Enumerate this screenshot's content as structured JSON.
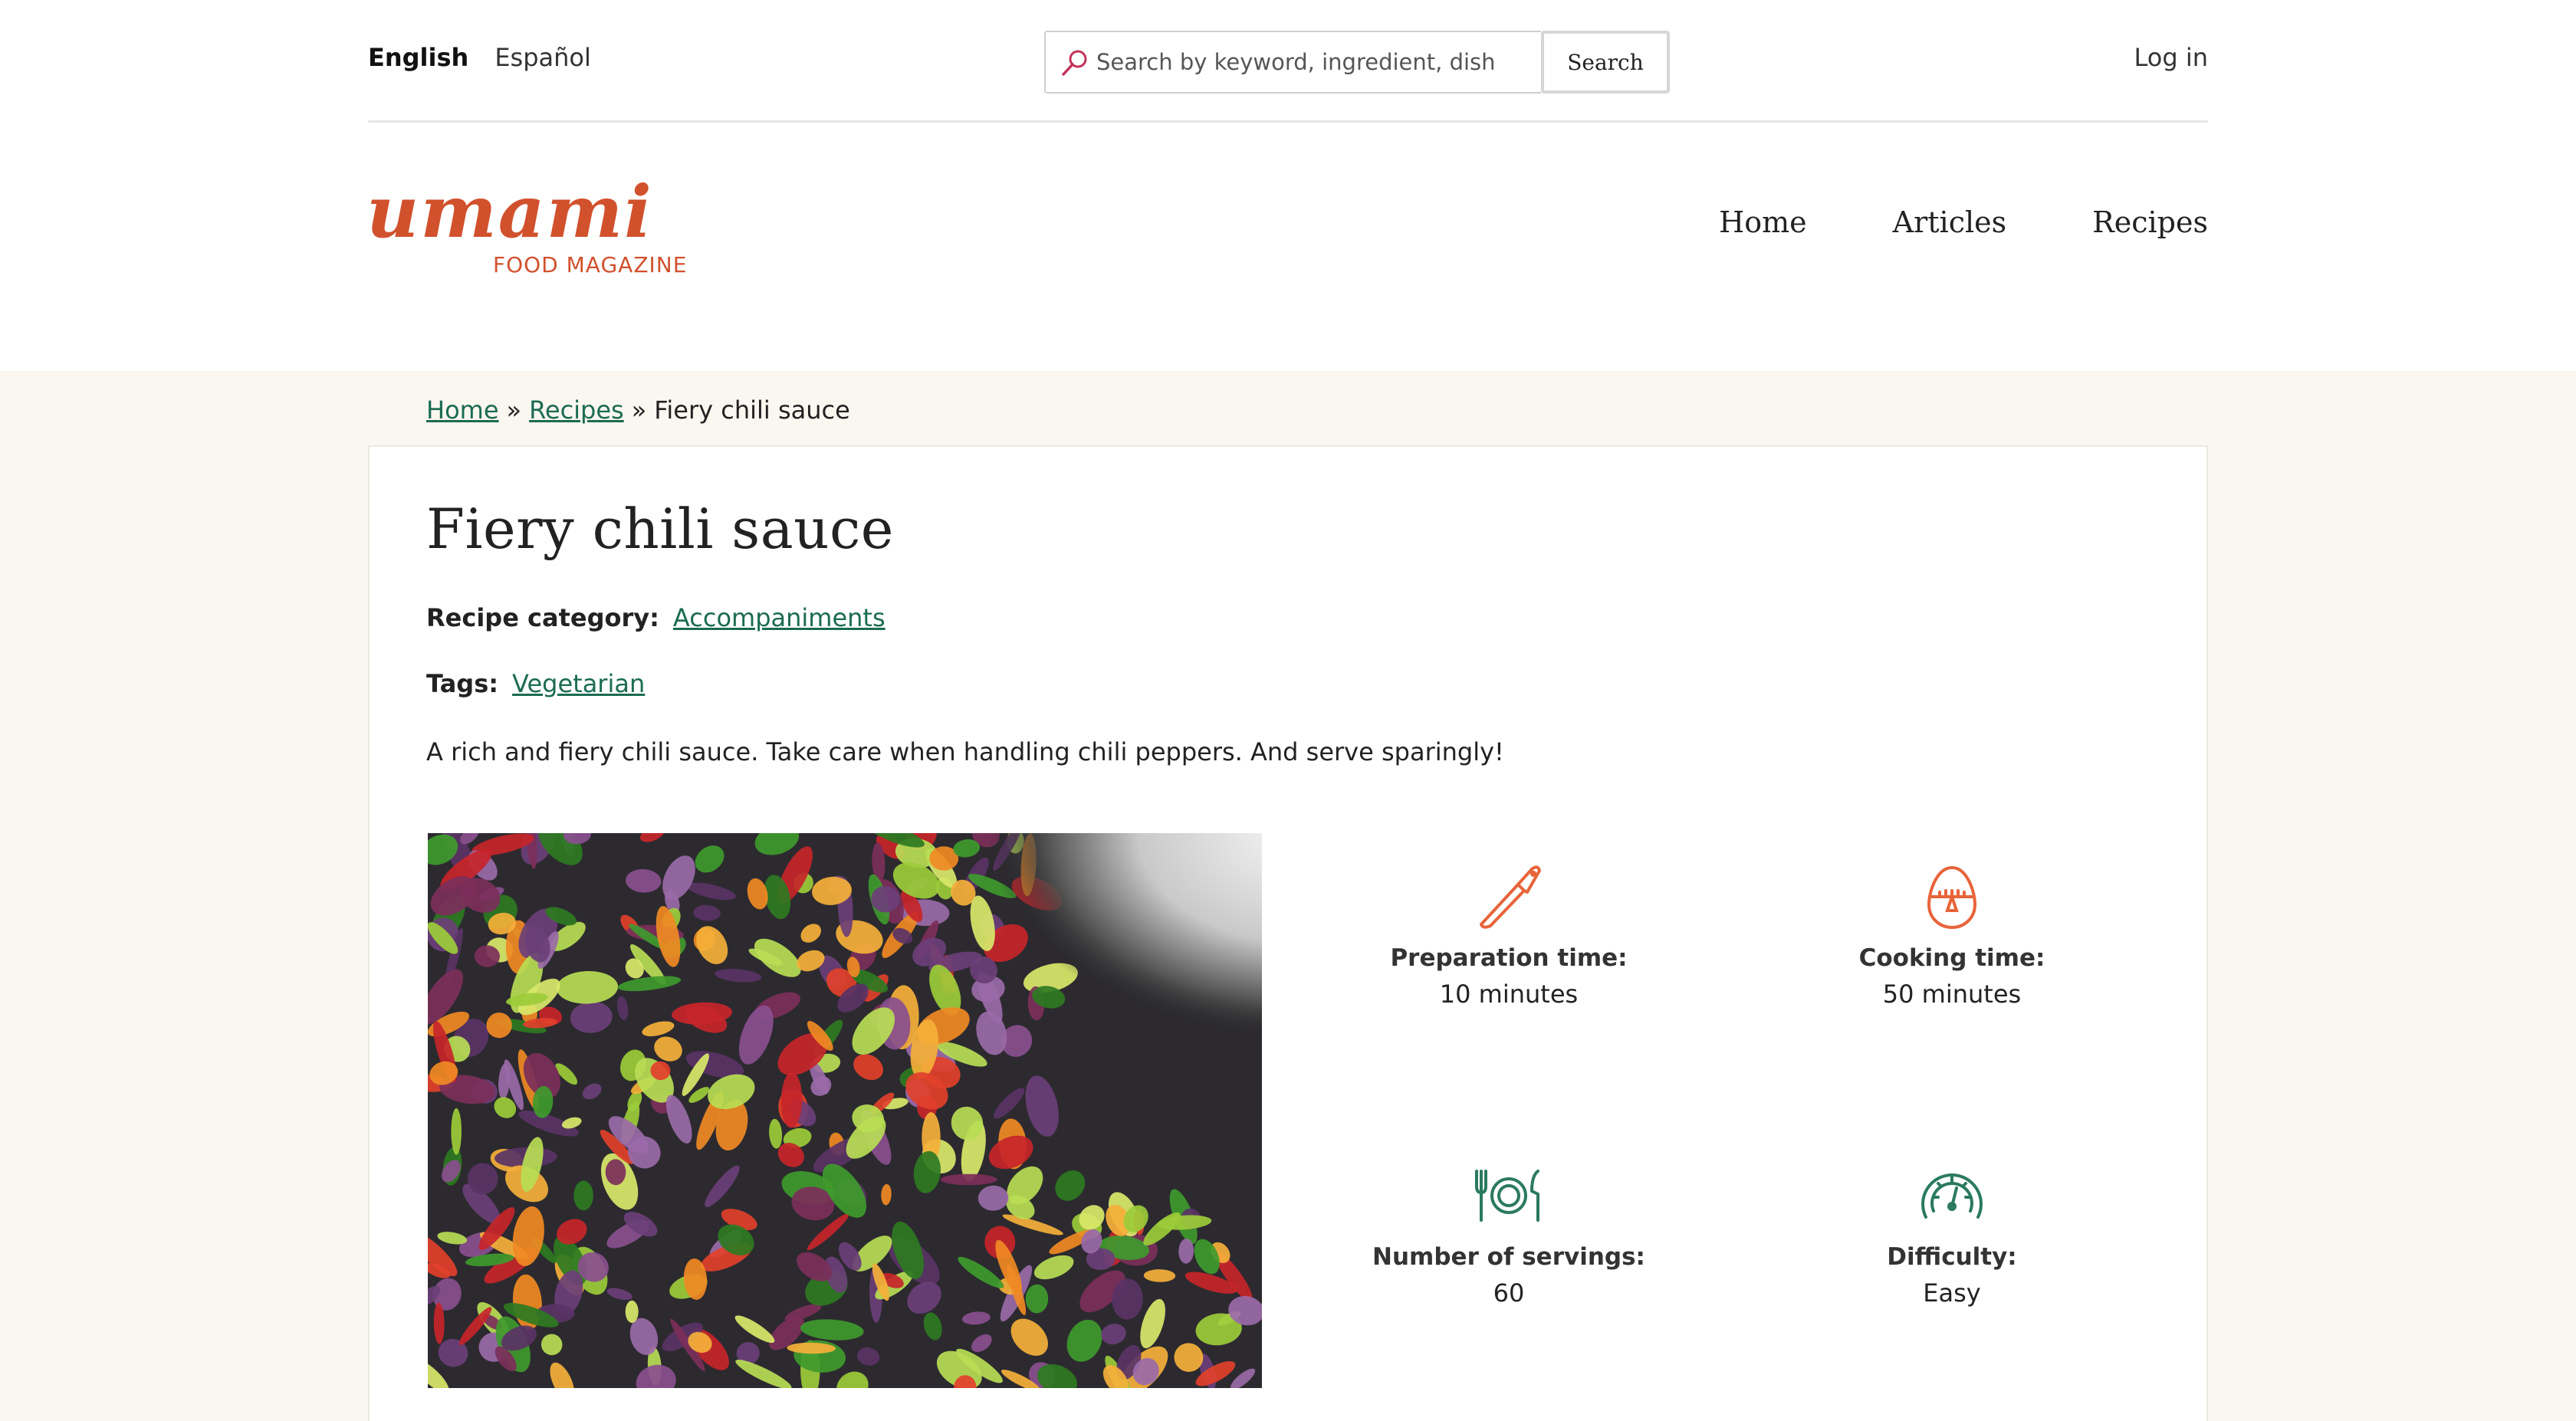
{
  "topbar": {
    "languages": [
      {
        "label": "English",
        "active": true
      },
      {
        "label": "Español",
        "active": false
      }
    ],
    "search": {
      "placeholder": "Search by keyword, ingredient, dish",
      "value": "",
      "button_label": "Search"
    },
    "login_label": "Log in"
  },
  "header": {
    "logo_text": "umami",
    "logo_subtitle": "FOOD MAGAZINE",
    "nav": [
      "Home",
      "Articles",
      "Recipes"
    ]
  },
  "breadcrumb": {
    "items": [
      "Home",
      "Recipes"
    ],
    "current": "Fiery chili sauce",
    "separator": "»"
  },
  "recipe": {
    "title": "Fiery chili sauce",
    "category_label": "Recipe category:",
    "category": "Accompaniments",
    "tags_label": "Tags:",
    "tags": [
      "Vegetarian"
    ],
    "summary": "A rich and fiery chili sauce. Take care when handling chili peppers. And serve sparingly!",
    "stats": {
      "prep": {
        "label": "Preparation time:",
        "value": "10 minutes",
        "icon": "knife-icon"
      },
      "cook": {
        "label": "Cooking time:",
        "value": "50 minutes",
        "icon": "egg-timer-icon"
      },
      "servings": {
        "label": "Number of servings:",
        "value": "60",
        "icon": "plate-cutlery-icon"
      },
      "difficulty": {
        "label": "Difficulty:",
        "value": "Easy",
        "icon": "gauge-icon"
      }
    }
  },
  "colors": {
    "brand": "#d1512d",
    "link": "#1b6b52",
    "icon_orange": "#e8643a",
    "icon_green": "#2a7a5f",
    "band": "#faf6f0"
  }
}
